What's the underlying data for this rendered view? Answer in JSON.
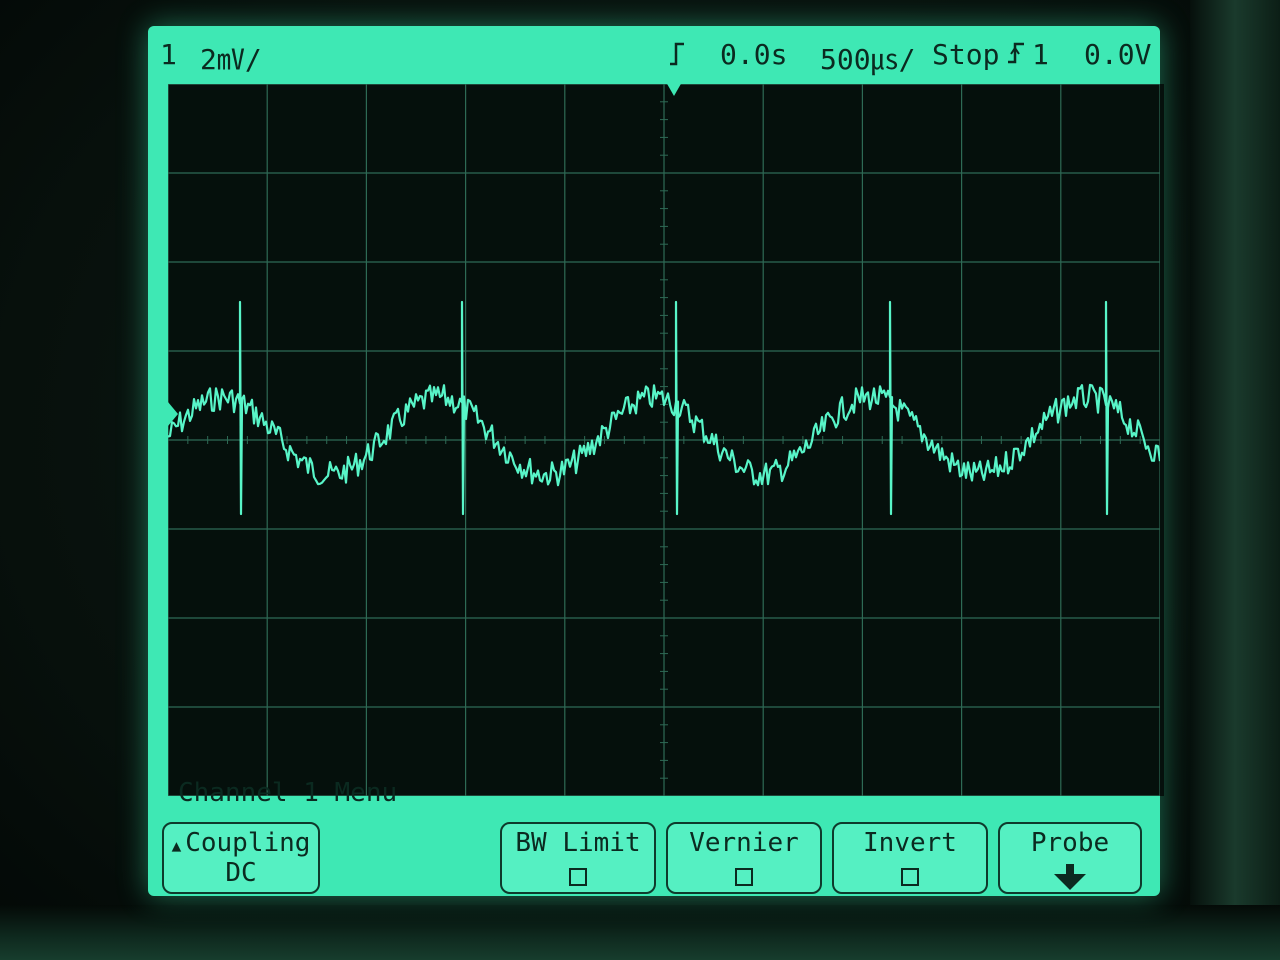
{
  "status": {
    "channel": "1",
    "volts_per_div": "2㎷/",
    "delay": "0.0s",
    "time_per_div": "500㎲/",
    "run_state": "Stop",
    "trigger_channel": "1",
    "trigger_level": "0.0V"
  },
  "menu": {
    "title": "Channel 1 Menu"
  },
  "softkeys": {
    "coupling_label": "Coupling",
    "coupling_value": "DC",
    "bw_limit_label": "BW Limit",
    "vernier_label": "Vernier",
    "invert_label": "Invert",
    "probe_label": "Probe"
  },
  "colors": {
    "trace": "#58f5c8",
    "grid": "#2e6a55",
    "screen_background": "#05100c",
    "phosphor": "#3ee8b4"
  },
  "icons": {
    "trigger_edge": "rising-edge-icon",
    "trigger_position": "down-triangle-icon",
    "ground_marker": "ground-marker-icon",
    "coupling_arrow": "up-triangle-icon",
    "probe_arrow": "down-arrow-icon"
  }
}
